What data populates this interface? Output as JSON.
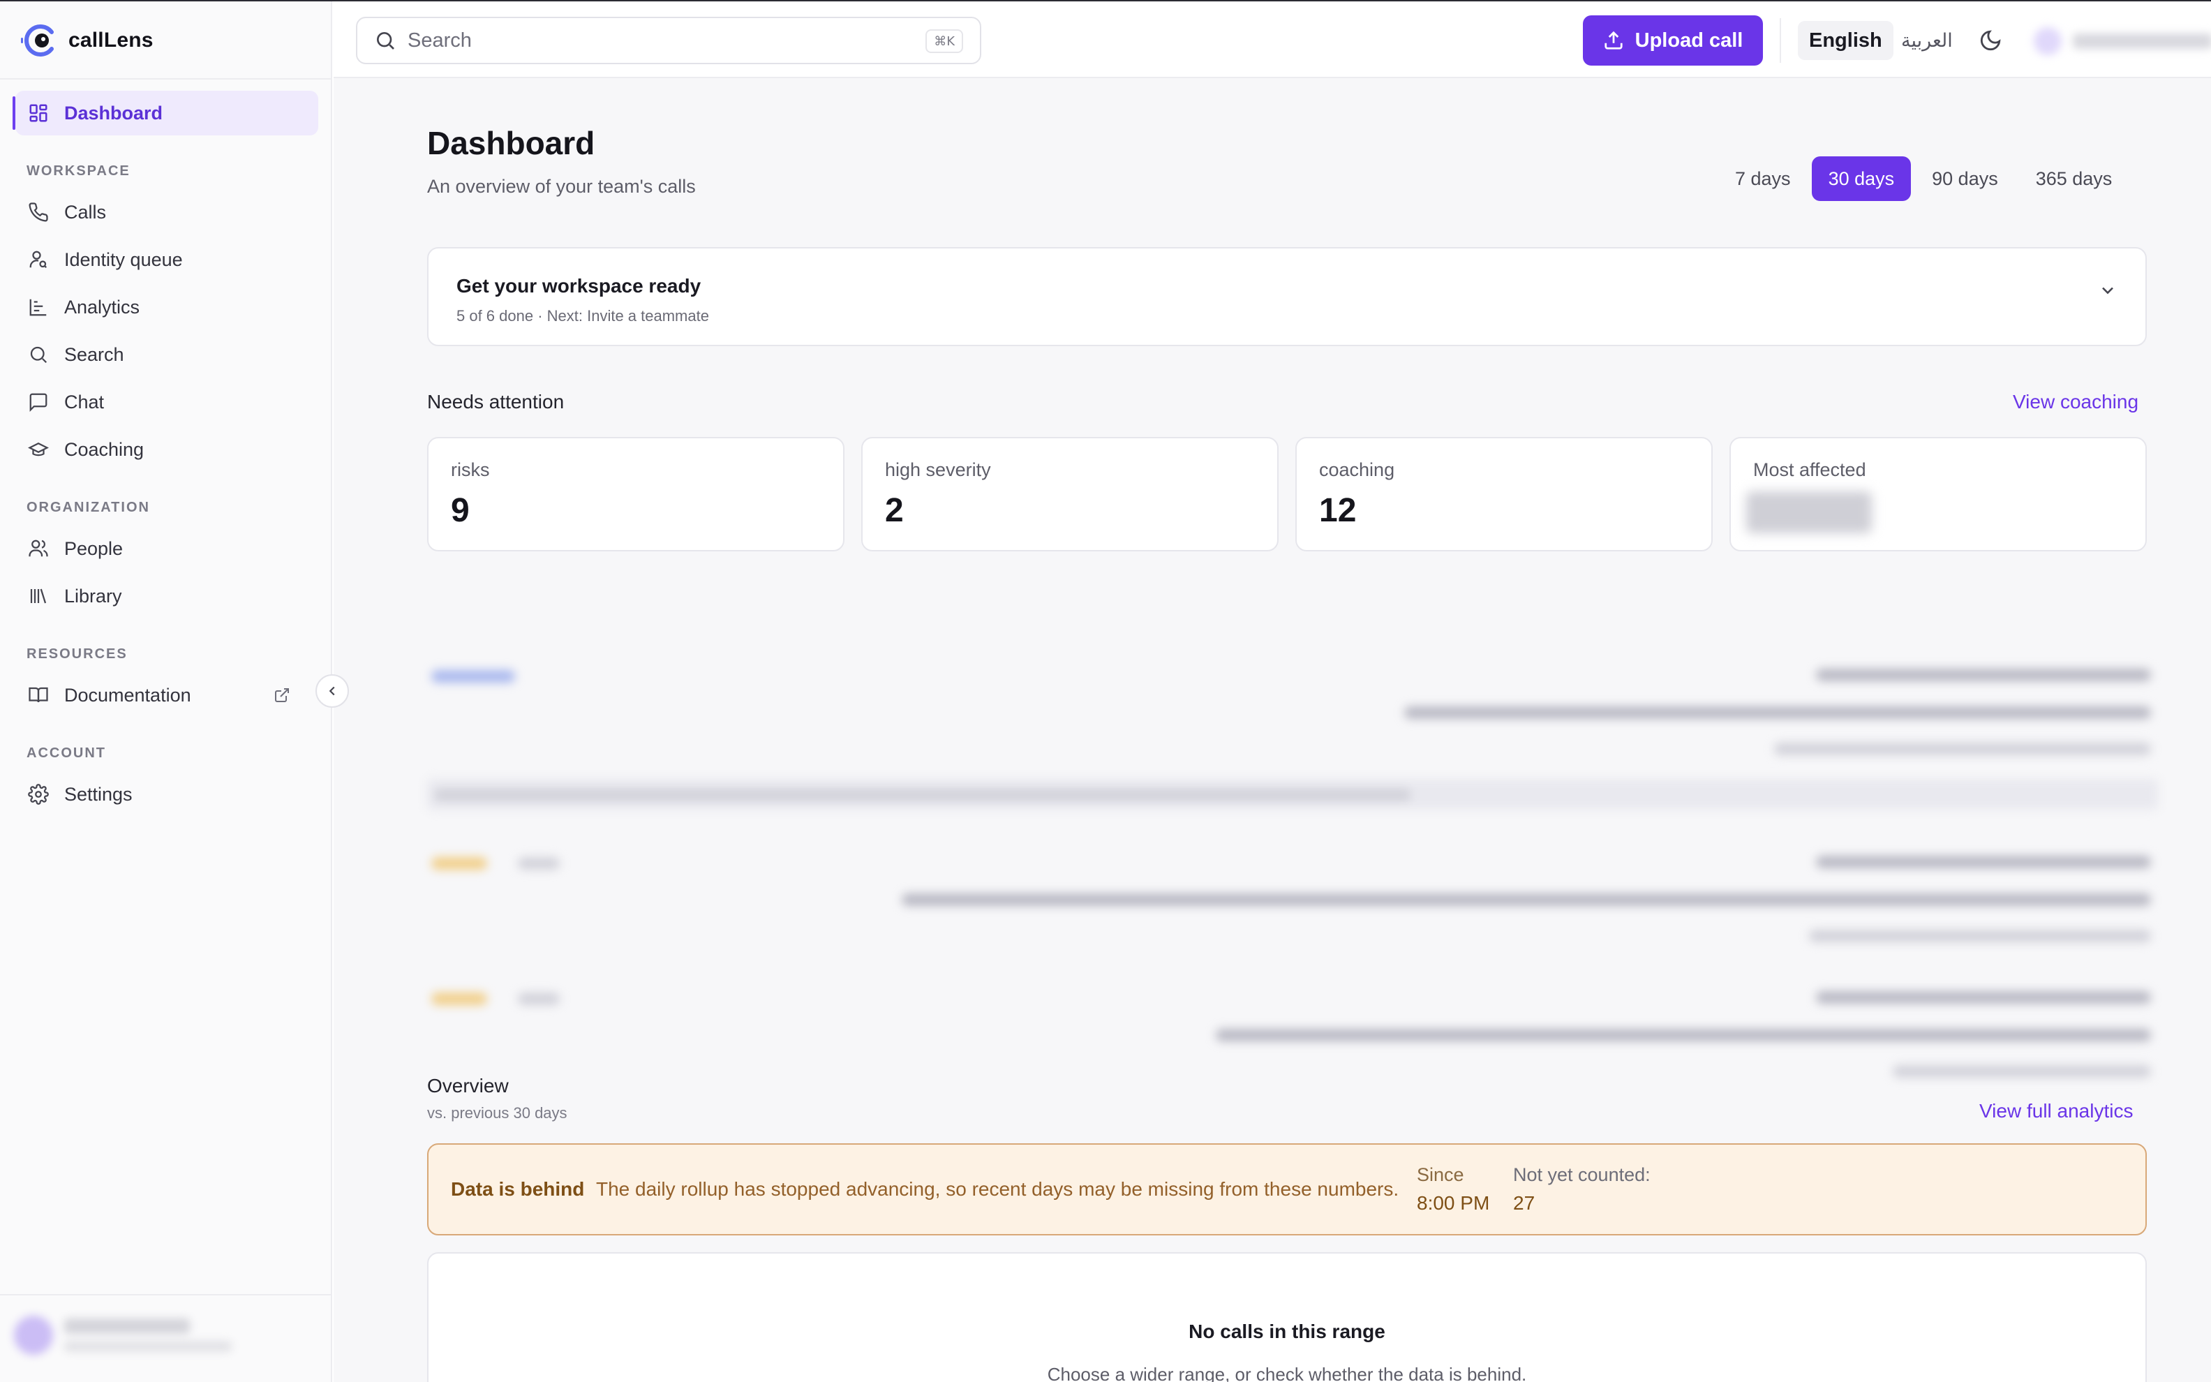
{
  "app": {
    "name": "callLens"
  },
  "sidebar": {
    "primary": {
      "label": "Dashboard",
      "icon": "layout-grid-icon"
    },
    "sections": {
      "workspace": "WORKSPACE",
      "organization": "ORGANIZATION",
      "resources": "RESOURCES",
      "account": "ACCOUNT"
    },
    "items": {
      "calls": "Calls",
      "identity_queue": "Identity queue",
      "analytics": "Analytics",
      "search": "Search",
      "chat": "Chat",
      "coaching": "Coaching",
      "people": "People",
      "library": "Library",
      "documentation": "Documentation",
      "settings": "Settings"
    }
  },
  "header": {
    "search_placeholder": "Search",
    "search_shortcut": "⌘K",
    "upload_label": "Upload call",
    "lang_en": "English",
    "lang_ar": "العربية"
  },
  "page": {
    "title": "Dashboard",
    "subtitle": "An overview of your team's calls",
    "ranges": [
      "7 days",
      "30 days",
      "90 days",
      "365 days"
    ],
    "selected_range": "30 days"
  },
  "setup": {
    "title": "Get your workspace ready",
    "progress": "5 of 6 done · Next: Invite a teammate"
  },
  "attention": {
    "title": "Needs attention",
    "link": "View coaching",
    "stats": [
      {
        "label": "risks",
        "value": "9"
      },
      {
        "label": "high severity",
        "value": "2"
      },
      {
        "label": "coaching",
        "value": "12"
      },
      {
        "label": "Most affected",
        "value": ""
      }
    ]
  },
  "overview": {
    "title": "Overview",
    "subtitle": "vs. previous 30 days",
    "link": "View full analytics",
    "alert": {
      "title": "Data is behind",
      "message": "The daily rollup has stopped advancing, so recent days may be missing from these numbers.",
      "since_label": "Since",
      "since_value": "8:00 PM",
      "pending_label": "Not yet counted:",
      "pending_value": "27"
    },
    "empty": {
      "title": "No calls in this range",
      "subtitle": "Choose a wider range, or check whether the data is behind."
    }
  },
  "colors": {
    "accent": "#6a35e8",
    "accent_soft": "#efeafd",
    "warning_bg": "#fdf2e4",
    "warning_border": "#d8a878"
  }
}
